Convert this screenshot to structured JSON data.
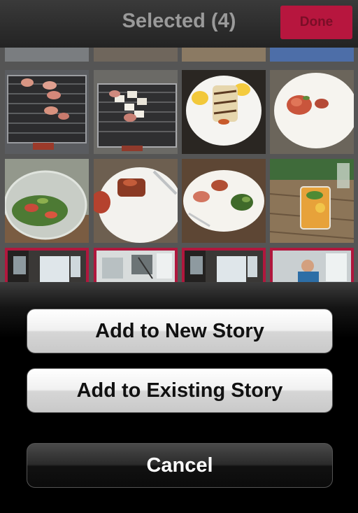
{
  "navbar": {
    "title": "Selected (4)",
    "done_label": "Done"
  },
  "colors": {
    "accent": "#b7163e",
    "selection_border": "#b0173d"
  },
  "photos": [
    "grill-photo",
    "grill-halloumi-photo",
    "halloumi-plate-photo",
    "salad-plate-photo",
    "bowl-salad-photo",
    "plate-meat-photo",
    "plate-food-photo",
    "drink-glass-photo",
    "room-photo-selected",
    "room-photo-selected",
    "room-photo-selected",
    "person-photo-selected"
  ],
  "action_sheet": {
    "add_new_story": "Add to New Story",
    "add_existing_story": "Add to Existing Story",
    "cancel": "Cancel"
  }
}
